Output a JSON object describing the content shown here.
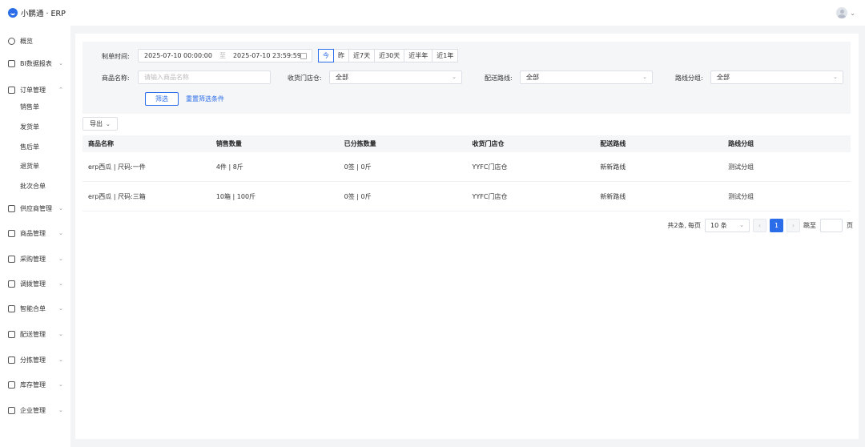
{
  "app": {
    "title": "小鹏通 · ERP"
  },
  "sidebar": {
    "items": [
      {
        "label": "概览",
        "icon": "clock-icon"
      },
      {
        "label": "BI数据报表",
        "icon": "report-icon"
      },
      {
        "label": "订单管理",
        "icon": "order-icon",
        "expanded": true
      },
      {
        "label": "供应商管理",
        "icon": "supplier-icon"
      },
      {
        "label": "商品管理",
        "icon": "goods-icon"
      },
      {
        "label": "采购管理",
        "icon": "purchase-icon"
      },
      {
        "label": "调拨管理",
        "icon": "transfer-icon"
      },
      {
        "label": "智能合单",
        "icon": "grid-icon"
      },
      {
        "label": "配送管理",
        "icon": "truck-icon"
      },
      {
        "label": "分拣管理",
        "icon": "sort-icon"
      },
      {
        "label": "库存管理",
        "icon": "inventory-icon"
      },
      {
        "label": "企业管理",
        "icon": "enterprise-icon"
      }
    ],
    "submenu": [
      "销售单",
      "发货单",
      "售后单",
      "退货单",
      "批次合单"
    ]
  },
  "filters": {
    "date_label": "制单时间:",
    "date_start": "2025-07-10 00:00:00",
    "date_sep": "至",
    "date_end": "2025-07-10 23:59:59",
    "quick": [
      "今",
      "昨",
      "近7天",
      "近30天",
      "近半年",
      "近1年"
    ],
    "product_label": "商品名称:",
    "product_placeholder": "请输入商品名称",
    "store_label": "收货门店仓:",
    "store_value": "全部",
    "route_label": "配送路线:",
    "route_value": "全部",
    "group_label": "路线分组:",
    "group_value": "全部",
    "filter_button": "筛选",
    "reset_link": "重置筛选条件"
  },
  "toolbar": {
    "export_label": "导出"
  },
  "table": {
    "columns": [
      "商品名称",
      "销售数量",
      "已分拣数量",
      "收货门店仓",
      "配送路线",
      "路线分组"
    ],
    "rows": [
      [
        "erp西瓜 | 尺码:一件",
        "4件 | 8斤",
        "0签 | 0斤",
        "YYFC门店仓",
        "新新路线",
        "测试分组"
      ],
      [
        "erp西瓜 | 尺码:三箱",
        "10箱 | 100斤",
        "0签 | 0斤",
        "YYFC门店仓",
        "新新路线",
        "测试分组"
      ]
    ]
  },
  "pagination": {
    "total_text": "共2条,",
    "per_page_label": "每页",
    "page_size": "10 条",
    "prev": "‹",
    "current_page": "1",
    "next": "›",
    "jump_label": "跳至",
    "page_suffix": "页"
  },
  "colors": {
    "accent": "#2b6de8",
    "bg": "#f3f4f6"
  }
}
